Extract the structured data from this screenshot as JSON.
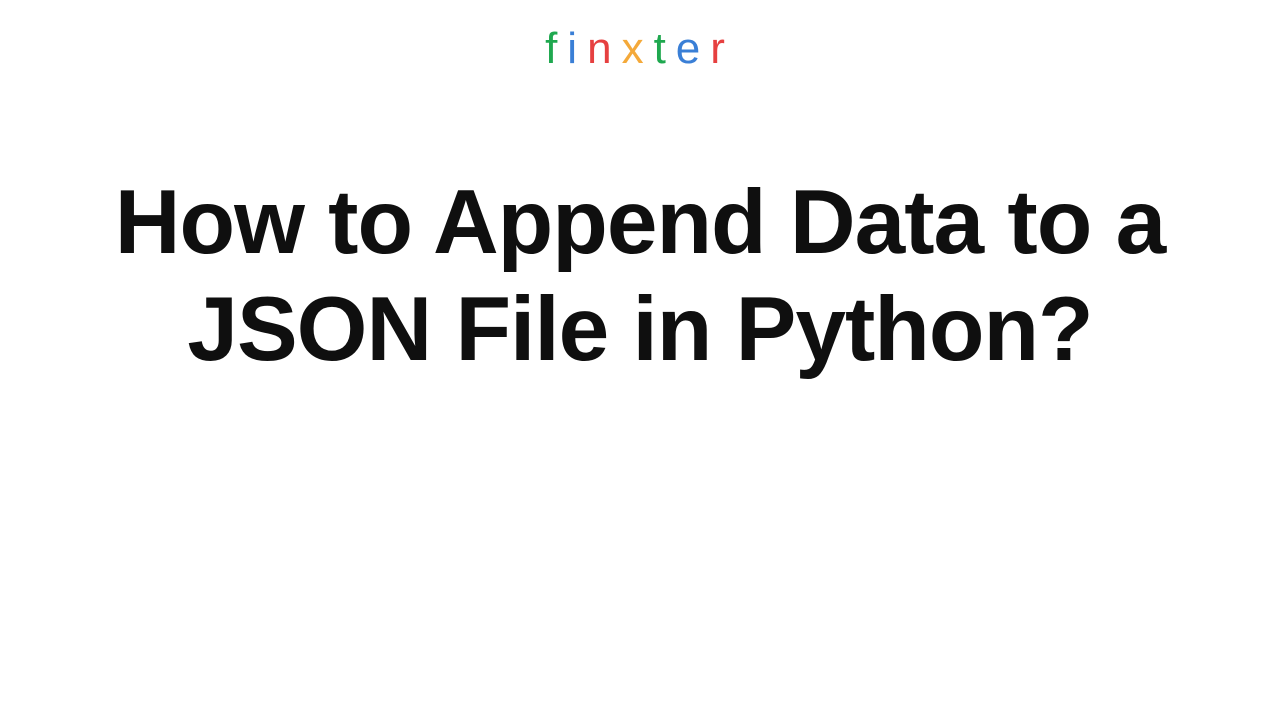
{
  "logo": {
    "letters": [
      "f",
      "i",
      "n",
      "x",
      "t",
      "e",
      "r"
    ]
  },
  "title": {
    "line1": "How to Append Data to a",
    "line2": "JSON File in Python?"
  }
}
